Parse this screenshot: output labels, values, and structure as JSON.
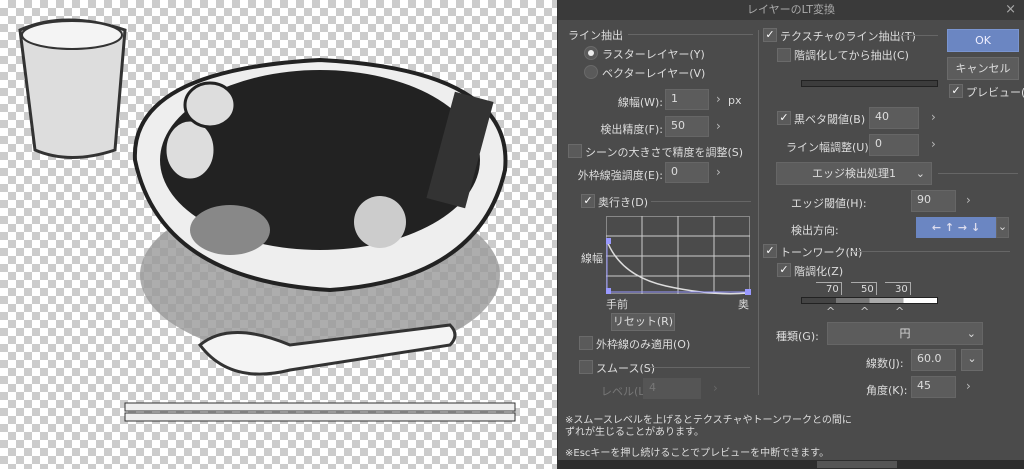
{
  "dialog": {
    "title": "レイヤーのLT変換",
    "close": "×"
  },
  "line": {
    "section": "ライン抽出",
    "raster": "ラスターレイヤー(Y)",
    "vector": "ベクターレイヤー(V)",
    "width_label": "線幅(W):",
    "width_value": "1",
    "width_unit": "px",
    "precision_label": "検出精度(F):",
    "precision_value": "50",
    "scene_label": "シーンの大きさで精度を調整(S)",
    "outer_label": "外枠線強調度(E):",
    "outer_value": "0",
    "depth_label": "奥行き(D)",
    "graph_y": "線幅",
    "graph_near": "手前",
    "graph_far": "奥",
    "reset": "リセット(R)",
    "outer_only": "外枠線のみ適用(O)",
    "smooth": "スムース(S)",
    "level_label": "レベル(L):",
    "level_value": "4"
  },
  "texture": {
    "label": "テクスチャのライン抽出(T)",
    "posterize": "階調化してから抽出(C)",
    "black_label": "黒ベタ閾値(B)",
    "black_value": "40",
    "linewidth_label": "ライン幅調整(U):",
    "linewidth_value": "0",
    "edge_process": "エッジ検出処理1",
    "edge_label": "エッジ閾値(H):",
    "edge_value": "90",
    "dir_label": "検出方向:",
    "dir_arrows": "← ↑ → ↓"
  },
  "tone": {
    "label": "トーンワーク(N)",
    "posterize": "階調化(Z)",
    "levels": [
      "70",
      "50",
      "30"
    ],
    "type_label": "種類(G):",
    "type_value": "円",
    "lines_label": "線数(J):",
    "lines_value": "60.0",
    "angle_label": "角度(K):",
    "angle_value": "45"
  },
  "buttons": {
    "ok": "OK",
    "cancel": "キャンセル",
    "preview": "プレビュー(P)"
  },
  "notes": [
    "※スムースレベルを上げるとテクスチャやトーンワークとの間に",
    "ずれが生じることがあります。",
    "※Escキーを押し続けることでプレビューを中断できます。"
  ],
  "colors": {
    "accent": "#6b86c2",
    "bg": "#4b4b4b"
  }
}
